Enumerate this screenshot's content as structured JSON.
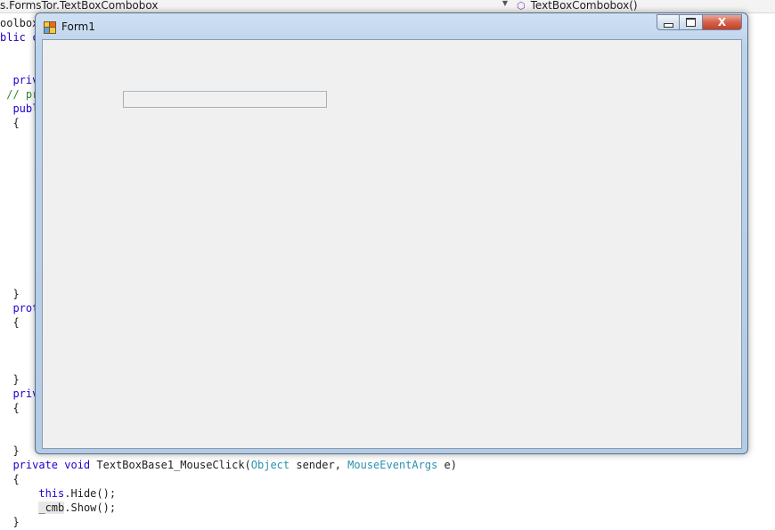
{
  "navigation": {
    "type_selector": "s.FormsTor.TextBoxCombobox",
    "member_selector": "TextBoxCombobox()",
    "member_icon": "cube-icon"
  },
  "code_lines": [
    {
      "parts": [
        {
          "t": "oolbox",
          "c": ""
        }
      ]
    },
    {
      "parts": [
        {
          "t": "blic c",
          "c": "kw"
        }
      ]
    },
    {
      "parts": [
        {
          "t": "  priv",
          "c": "kw"
        }
      ]
    },
    {
      "parts": [
        {
          "t": " // pr",
          "c": "cmt"
        }
      ]
    },
    {
      "parts": [
        {
          "t": "  publ",
          "c": "kw"
        }
      ]
    },
    {
      "parts": [
        {
          "t": "  {",
          "c": ""
        }
      ]
    },
    {
      "parts": [
        {
          "t": "  }",
          "c": ""
        }
      ]
    },
    {
      "parts": [
        {
          "t": "  prot",
          "c": "kw"
        }
      ]
    },
    {
      "parts": [
        {
          "t": "  {",
          "c": ""
        }
      ]
    },
    {
      "parts": [
        {
          "t": "  }",
          "c": ""
        }
      ]
    },
    {
      "parts": [
        {
          "t": "  priv",
          "c": "kw"
        }
      ]
    },
    {
      "parts": [
        {
          "t": "  {",
          "c": ""
        }
      ]
    },
    {
      "parts": [
        {
          "t": "  }",
          "c": ""
        }
      ]
    },
    {
      "parts": [
        {
          "t": "  private void ",
          "c": "kw"
        },
        {
          "t": "TextBoxBase1_MouseClick(",
          "c": ""
        },
        {
          "t": "Object",
          "c": "type"
        },
        {
          "t": " sender, ",
          "c": ""
        },
        {
          "t": "MouseEventArgs",
          "c": "type"
        },
        {
          "t": " e)",
          "c": ""
        }
      ]
    },
    {
      "parts": [
        {
          "t": "  {",
          "c": ""
        }
      ]
    },
    {
      "parts": [
        {
          "t": "      ",
          "c": ""
        },
        {
          "t": "this",
          "c": "kw"
        },
        {
          "t": ".Hide();",
          "c": ""
        }
      ]
    },
    {
      "parts": [
        {
          "t": "      ",
          "c": ""
        },
        {
          "t": "_cmb",
          "c": "hl"
        },
        {
          "t": ".Show();",
          "c": ""
        }
      ]
    },
    {
      "parts": [
        {
          "t": "  }",
          "c": ""
        }
      ]
    }
  ],
  "window": {
    "title": "Form1",
    "title_icon": "form-app-icon",
    "close_glyph": "X",
    "textbox_value": ""
  }
}
